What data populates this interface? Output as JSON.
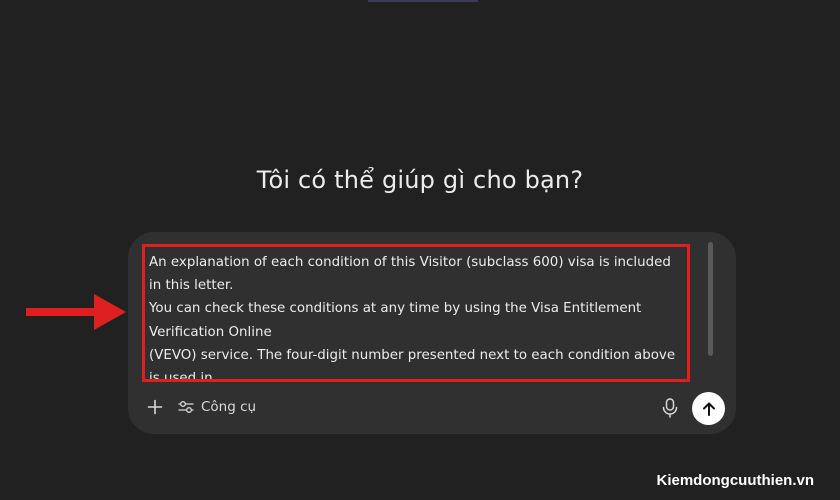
{
  "main": {
    "heading": "Tôi có thể giúp gì cho bạn?"
  },
  "composer": {
    "prompt_text": "An explanation of each condition of this Visitor (subclass 600) visa is included in this letter.\nYou can check these conditions at any time by using the Visa Entitlement Verification Online\n(VEVO) service. The four-digit number presented next to each condition above is used in",
    "add_icon": "plus-icon",
    "tools_label": "Công cụ",
    "tools_icon": "sliders-icon",
    "mic_icon": "microphone-icon",
    "send_icon": "arrow-up-icon"
  },
  "annotation": {
    "highlight_color": "#e02020",
    "arrow_icon": "arrow-right-icon"
  },
  "watermark": {
    "text": "Kiemdongcuuthien.vn"
  },
  "colors": {
    "background": "#212121",
    "composer_background": "#303030",
    "send_button": "#ffffff"
  }
}
